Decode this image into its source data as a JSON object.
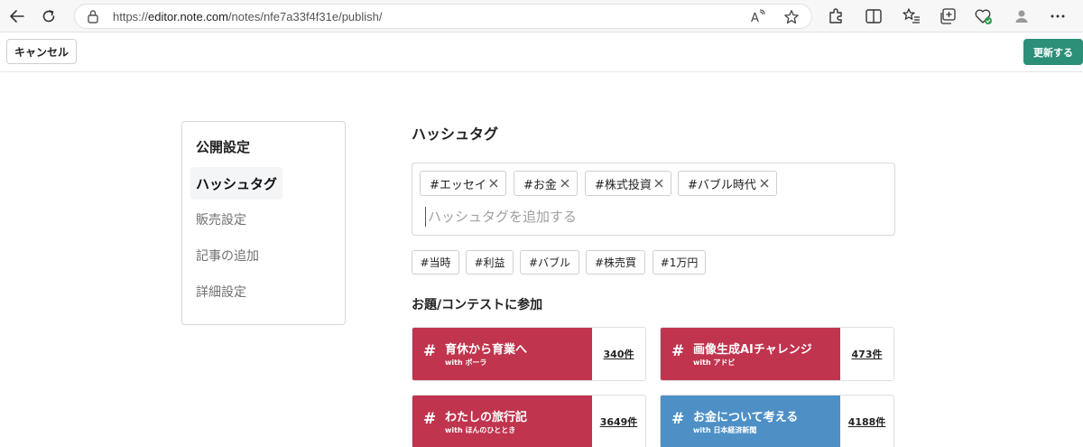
{
  "browser": {
    "url_scheme": "https://",
    "url_host": "editor.note.com",
    "url_path": "/notes/nfe7a33f4f31e/publish/",
    "icons": [
      "back-icon",
      "refresh-icon",
      "lock-icon",
      "read-aloud-icon",
      "favorite-star-icon",
      "extensions-icon",
      "split-screen-icon",
      "favorites-icon",
      "collections-icon",
      "heart-pulse-icon",
      "profile-icon",
      "more-icon"
    ]
  },
  "header": {
    "cancel_label": "キャンセル",
    "update_label": "更新する",
    "update_color": "#2c8f78"
  },
  "menu": {
    "title": "公開設定",
    "items": [
      {
        "label": "ハッシュタグ",
        "active": true
      },
      {
        "label": "販売設定",
        "active": false
      },
      {
        "label": "記事の追加",
        "active": false
      },
      {
        "label": "詳細設定",
        "active": false
      }
    ]
  },
  "hashtag": {
    "title": "ハッシュタグ",
    "tags": [
      "#エッセイ",
      "#お金",
      "#株式投資",
      "#バブル時代"
    ],
    "input_placeholder": "ハッシュタグを追加する",
    "suggestions": [
      "#当時",
      "#利益",
      "#バブル",
      "#株売買",
      "#1万円"
    ]
  },
  "contests": {
    "title": "お題/コンテストに参加",
    "hash_symbol": "#",
    "cards": [
      {
        "title": "育休から育業へ",
        "sponsor": "with ポーラ",
        "count": "340件",
        "color": "#c0344e"
      },
      {
        "title": "画像生成AIチャレンジ",
        "sponsor": "with アドビ",
        "count": "473件",
        "color": "#c0344e"
      },
      {
        "title": "わたしの旅行記",
        "sponsor": "with ほんのひととき",
        "count": "3649件",
        "color": "#c0344e"
      },
      {
        "title": "お金について考える",
        "sponsor": "with 日本経済新聞",
        "count": "4188件",
        "color": "#4e90c6"
      }
    ]
  }
}
